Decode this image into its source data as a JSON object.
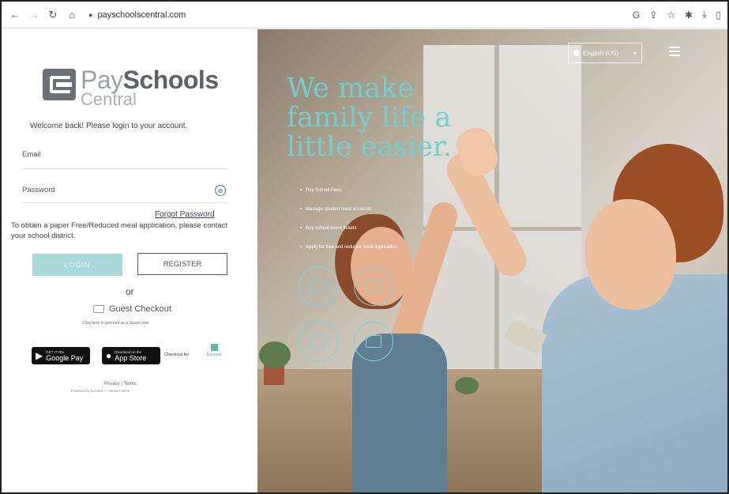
{
  "browser": {
    "url": "payschoolscentral.com",
    "back_icon": "arrow-left-icon",
    "forward_icon": "arrow-right-icon",
    "reload_icon": "reload-icon",
    "home_icon": "home-icon"
  },
  "logo": {
    "pay": "Pay",
    "schools": "Schools",
    "central": "Central"
  },
  "login": {
    "welcome": "Welcome back! Please login to your account.",
    "email_label": "Email",
    "password_label": "Password",
    "forgot": "Forgot Password",
    "info": "To obtain a paper Free/Reduced meal application, please contact your school district.",
    "login_btn": "LOGIN",
    "register_btn": "REGISTER",
    "or": "or",
    "guest": "Guest Checkout",
    "guest_note": "Click here to proceed as a Guest User",
    "google_pay_small": "GET IT ON",
    "google_pay": "Google Pay",
    "app_store_small": "Download on the",
    "app_store": "App Store",
    "checkout_for": "Checkout for",
    "brand_mini": "Exceed",
    "privacy": "Privacy | Terms",
    "powered": "Powered by Exceed — Version 2023"
  },
  "hero": {
    "language": "English (US)",
    "headline": "We make family life a little easier.",
    "bullets": [
      "Pay School Fees",
      "Manage student meal accounts",
      "Buy school event tickets",
      "Apply for free and reduced meal application"
    ]
  },
  "colors": {
    "accent": "#6fd0cf",
    "login_btn_bg": "#a9dadb",
    "logo_gray": "#5e6266"
  }
}
